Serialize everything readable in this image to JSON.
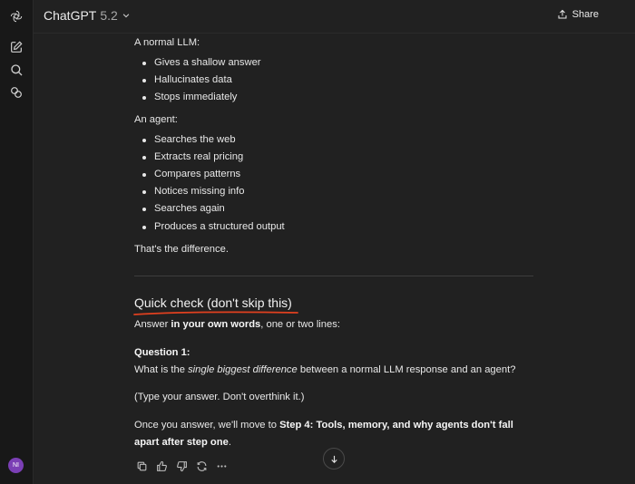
{
  "header": {
    "model_name": "ChatGPT",
    "model_version": "5.2",
    "share_label": "Share"
  },
  "sidebar": {
    "avatar_initials": "NI"
  },
  "message": {
    "llm_title": "A normal LLM:",
    "llm_items": [
      "Gives a shallow answer",
      "Hallucinates data",
      "Stops immediately"
    ],
    "agent_title": "An agent:",
    "agent_items": [
      "Searches the web",
      "Extracts real pricing",
      "Compares patterns",
      "Notices missing info",
      "Searches again",
      "Produces a structured output"
    ],
    "difference": "That's the difference.",
    "quick_check_heading": "Quick check (don't skip this)",
    "answer_prefix": "Answer ",
    "answer_bold": "in your own words",
    "answer_suffix": ", one or two lines:",
    "question_label": "Question 1:",
    "question_prefix": "What is the ",
    "question_italic": "single biggest difference",
    "question_suffix": " between a normal LLM response and an agent?",
    "type_hint": "(Type your answer. Don't overthink it.)",
    "next_prefix": "Once you answer, we'll move to ",
    "next_bold_line1": "Step 4: Tools, memory, and why agents don't fall",
    "next_bold_line2": "apart after step one",
    "next_suffix": "."
  },
  "colors": {
    "background": "#212121",
    "sidebar": "#181818",
    "underline_accent": "#e0401f",
    "avatar": "#7b3fb5"
  },
  "icons": [
    "openai-logo-icon",
    "new-chat-icon",
    "search-icon",
    "gpts-icon",
    "chevron-down-icon",
    "share-icon",
    "copy-icon",
    "thumbs-up-icon",
    "thumbs-down-icon",
    "regenerate-icon",
    "more-icon",
    "arrow-down-icon"
  ]
}
